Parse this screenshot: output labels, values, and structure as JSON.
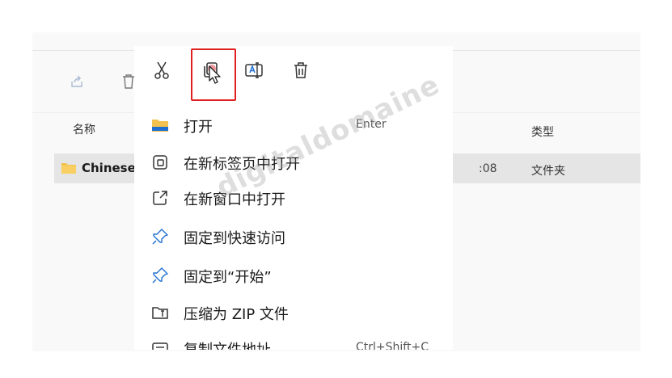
{
  "explorer": {
    "columns": {
      "name": "名称",
      "type": "类型"
    },
    "row": {
      "name": "Chinese",
      "modified_partial": ":08",
      "type": "文件夹"
    }
  },
  "context_menu": {
    "toolbar": [
      {
        "icon": "scissors-icon",
        "action": "cut"
      },
      {
        "icon": "copy-icon",
        "action": "copy",
        "highlighted": true
      },
      {
        "icon": "rename-icon",
        "action": "rename"
      },
      {
        "icon": "trash-icon",
        "action": "delete"
      }
    ],
    "items": [
      {
        "label": "打开",
        "shortcut": "Enter",
        "icon": "folder-icon"
      },
      {
        "label": "在新标签页中打开",
        "icon": "new-tab-icon"
      },
      {
        "label": "在新窗口中打开",
        "icon": "open-external-icon"
      },
      {
        "label": "固定到快速访问",
        "icon": "pin-icon"
      },
      {
        "label": "固定到“开始”",
        "icon": "pin-icon"
      },
      {
        "label": "压缩为 ZIP 文件",
        "icon": "zip-icon"
      },
      {
        "label": "复制文件地址",
        "shortcut": "Ctrl+Shift+C",
        "icon": "copy-path-icon"
      }
    ]
  },
  "watermark": "digitaldomaine",
  "colors": {
    "highlight": "#e02020",
    "folder": "#f2c14e",
    "folder_accent": "#1f6fd1"
  }
}
